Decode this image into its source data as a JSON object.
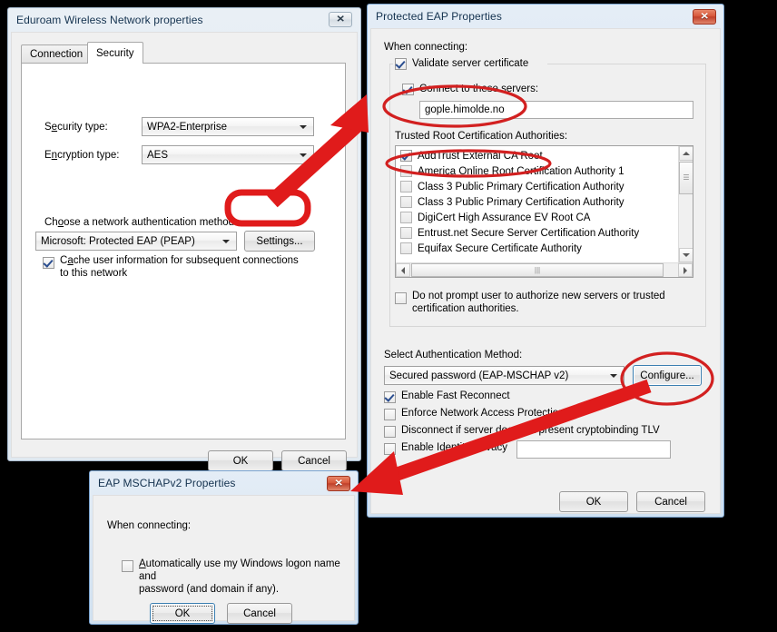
{
  "background_color": "#000000",
  "annotation_color": "#e01b1b",
  "network_dialog": {
    "title": "Eduroam Wireless Network properties",
    "close_label": "✕",
    "close_name": "close-icon",
    "tabs": [
      {
        "label": "Connection",
        "active": false
      },
      {
        "label": "Security",
        "active": true
      }
    ],
    "security_type_label": "Security type:",
    "security_type_label_parts": {
      "pre": "S",
      "accel": "e",
      "post": "curity type:"
    },
    "security_type_value": "WPA2-Enterprise",
    "encryption_type_label_parts": {
      "pre": "E",
      "accel": "n",
      "post": "cryption type:"
    },
    "encryption_type_value": "AES",
    "auth_method_label_parts": {
      "pre": "Ch",
      "accel": "o",
      "post": "ose a network authentication method:"
    },
    "auth_method_value": "Microsoft: Protected EAP (PEAP)",
    "settings_button": "Settings...",
    "cache_checkbox": {
      "checked": true,
      "line1_parts": {
        "pre": "C",
        "accel": "a",
        "post": "che user information for subsequent connections"
      },
      "line2": "to this network"
    },
    "ok_button": "OK",
    "cancel_button": "Cancel"
  },
  "peap_dialog": {
    "title": "Protected EAP Properties",
    "close_label": "✕",
    "close_name": "close-icon",
    "when_connecting_label": "When connecting:",
    "validate_server_certificate": {
      "label": "Validate server certificate",
      "checked": true
    },
    "connect_to_servers": {
      "label": "Connect to these servers:",
      "checked": true
    },
    "server_value": "gople.himolde.no",
    "trusted_roots_label": "Trusted Root Certification Authorities:",
    "trusted_roots": [
      {
        "label": "AddTrust External CA Root",
        "checked": true
      },
      {
        "label": "America Online Root Certification Authority 1",
        "checked": false
      },
      {
        "label": "Class 3 Public Primary Certification Authority",
        "checked": false
      },
      {
        "label": "Class 3 Public Primary Certification Authority",
        "checked": false
      },
      {
        "label": "DigiCert High Assurance EV Root CA",
        "checked": false
      },
      {
        "label": "Entrust.net Secure Server Certification Authority",
        "checked": false
      },
      {
        "label": "Equifax Secure Certificate Authority",
        "checked": false
      }
    ],
    "do_not_prompt": {
      "checked": false,
      "line1": "Do not prompt user to authorize new servers or trusted",
      "line2": "certification authorities."
    },
    "select_auth_method_label": "Select Authentication Method:",
    "auth_method_value": "Secured password (EAP-MSCHAP v2)",
    "configure_button": "Configure...",
    "options": [
      {
        "label": "Enable Fast Reconnect",
        "checked": true
      },
      {
        "label": "Enforce Network Access Protection",
        "checked": false
      },
      {
        "label": "Disconnect if server does not present cryptobinding TLV",
        "checked": false
      },
      {
        "label": "Enable Identity Privacy",
        "checked": false
      }
    ],
    "identity_privacy_value": "",
    "ok_button": "OK",
    "cancel_button": "Cancel"
  },
  "mschap_dialog": {
    "title": "EAP MSCHAPv2 Properties",
    "close_label": "✕",
    "close_name": "close-icon",
    "when_connecting_label": "When connecting:",
    "auto_logon_checkbox": {
      "checked": false,
      "line1_parts": {
        "pre": "",
        "accel": "A",
        "post": "utomatically use my Windows logon name and"
      },
      "line2": "password (and domain if any)."
    },
    "ok_button": "OK",
    "cancel_button": "Cancel"
  }
}
